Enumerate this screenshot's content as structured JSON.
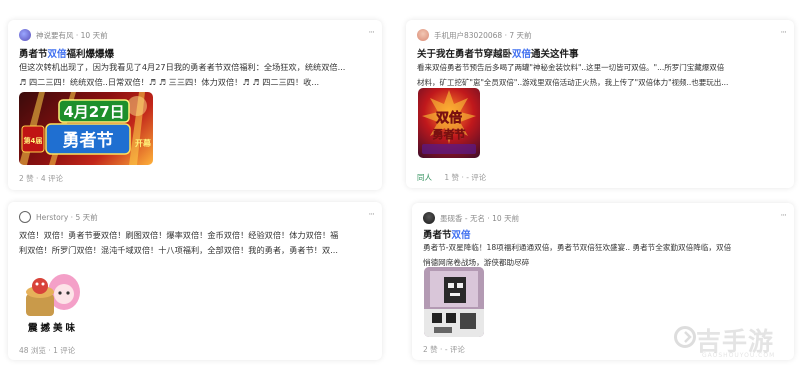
{
  "posts": [
    {
      "author": "神说要有风",
      "time": "10 天前",
      "title_prefix": "勇者节",
      "title_highlight": "双倍",
      "title_suffix": "福利爆爆爆",
      "lines": [
        "但这次转机出现了，因为我看见了4月27日我的勇者者节双倍福利：全场狂欢，统统双倍...",
        "♬ 四二三四！统统双倍..日常双倍！♬ ♬ 三三四！体力双倍！♬ ♬ 四二三四！收..."
      ],
      "likes": "2 赞",
      "comments": "4 评论",
      "image_text": [
        "4月27日",
        "第4届",
        "勇者节",
        "开幕"
      ]
    },
    {
      "author": "手机用户83020068",
      "time": "7 天前",
      "title_prefix": "关于我在勇者节穿越卧",
      "title_highlight": "双倍",
      "title_suffix": "通关这件事",
      "lines": [
        "看来双倍勇者节预告后多喝了两罐\"神秘金装饮料\"..这里一切皆可双倍。\"...所罗门宝藏爆双倍",
        "材料，矿工挖矿\"崽\"全员双倍\"..游戏里双倍活动正火热，我上传了\"双倍体力\"视频..也要玩出..."
      ],
      "tag": "同人",
      "likes": "1 赞",
      "comments": "- 评论",
      "image_text": [
        "双倍",
        "勇者节"
      ]
    },
    {
      "author": "Herstory",
      "time": "5 天前",
      "lines": [
        "双倍！双倍！勇者节要双倍！刷图双倍！爆率双倍！金币双倍！经验双倍！体力双倍！福",
        "利双倍！所罗门双倍！混沌千域双倍！十八项福利，全部双倍！我的勇者，勇者节！双..."
      ],
      "views": "48 浏览",
      "comments": "1 评论",
      "sticker_text": "震撼美味"
    },
    {
      "author": "墨砚香 - 无名",
      "time": "10 天前",
      "title_prefix": "勇者节",
      "title_highlight": "双倍",
      "title_suffix": "",
      "lines": [
        "勇者节-双星降临！18项福利通通双倍，勇者节双倍狂欢盛宴.. 勇者节全家勤双倍降临，双倍",
        "悄德网席卷战场，游侠都助尽碎"
      ],
      "likes": "2 赞",
      "comments": "- 评论"
    }
  ],
  "watermark": {
    "main": "吉手游",
    "sub": "GAOSHOUYOU.COM"
  },
  "colors": {
    "highlight": "#3f6ff0",
    "tag": "#2f8f5b"
  }
}
